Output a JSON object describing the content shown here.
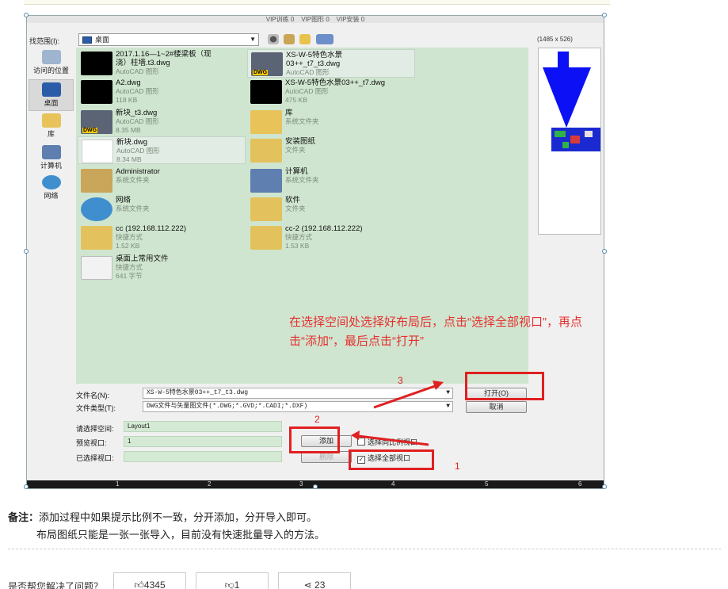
{
  "screenshot": {
    "top_text": "VIP训练 0    VIP图形 0    VIP安装 0",
    "look_in_label": "找范围(I):",
    "look_in_value": "桌面",
    "preview_dims": "(1485 x 526)",
    "places": [
      {
        "label": "访问的位置",
        "icon": "recent-places-icon"
      },
      {
        "label": "桌面",
        "icon": "desktop-icon",
        "selected": true
      },
      {
        "label": "库",
        "icon": "library-icon"
      },
      {
        "label": "计算机",
        "icon": "computer-icon"
      },
      {
        "label": "网络",
        "icon": "network-icon"
      }
    ],
    "files": [
      {
        "name": "2017.1.16—1~2#楼梁板（现",
        "name2": "浇）柱墙.t3.dwg",
        "type": "AutoCAD 图形",
        "size": "",
        "icon": "dwg-thumbnail"
      },
      {
        "name": "XS-W-5特色水景",
        "name2": "03++_t7_t3.dwg",
        "type": "AutoCAD 图形",
        "size": "",
        "icon": "dwg-file-icon"
      },
      {
        "name": "A2.dwg",
        "name2": "",
        "type": "AutoCAD 图形",
        "size": "118 KB",
        "icon": "dwg-thumbnail"
      },
      {
        "name": "XS-W-5特色水景03++_t7.dwg",
        "name2": "",
        "type": "AutoCAD 图形",
        "size": "475 KB",
        "icon": "dwg-thumbnail"
      },
      {
        "name": "新块_t3.dwg",
        "name2": "",
        "type": "AutoCAD 图形",
        "size": "8.35 MB",
        "icon": "dwg-file-icon"
      },
      {
        "name": "库",
        "name2": "",
        "type": "系统文件夹",
        "size": "",
        "icon": "library-folder-icon"
      },
      {
        "name": "新块.dwg",
        "name2": "",
        "type": "AutoCAD 图形",
        "size": "8.34 MB",
        "icon": "dwg-thumbnail"
      },
      {
        "name": "安装图纸",
        "name2": "",
        "type": "文件夹",
        "size": "",
        "icon": "folder-icon"
      },
      {
        "name": "Administrator",
        "name2": "",
        "type": "系统文件夹",
        "size": "",
        "icon": "user-folder-icon"
      },
      {
        "name": "计算机",
        "name2": "",
        "type": "系统文件夹",
        "size": "",
        "icon": "computer-icon"
      },
      {
        "name": "网络",
        "name2": "",
        "type": "系统文件夹",
        "size": "",
        "icon": "network-icon"
      },
      {
        "name": "软件",
        "name2": "",
        "type": "文件夹",
        "size": "",
        "icon": "folder-icon"
      },
      {
        "name": "cc (192.168.112.222)",
        "name2": "",
        "type": "快捷方式",
        "size": "1.52 KB",
        "icon": "shortcut-folder-icon"
      },
      {
        "name": "cc-2 (192.168.112.222)",
        "name2": "",
        "type": "快捷方式",
        "size": "1.53 KB",
        "icon": "shortcut-folder-icon"
      },
      {
        "name": "桌面上常用文件",
        "name2": "",
        "type": "快捷方式",
        "size": "641 字节",
        "icon": "shortcut-folder-icon"
      }
    ],
    "annotation": "在选择空间处选择好布局后，点击“选择全部视口”，再点击“添加”，最后点击“打开”",
    "filename_label": "文件名(N):",
    "filename_value": "XS-W-5特色水景03++_t7_t3.dwg",
    "filetype_label": "文件类型(T):",
    "filetype_value": "DWG文件与矢量图文件(*.DWG;*.GVD;*.CADI;*.DXF)",
    "open_button": "打开(O)",
    "cancel_button": "取消",
    "space_label": "请选择空间:",
    "space_value": "Layout1",
    "preview_label": "预览视口:",
    "preview_value": "1",
    "selected_label": "已选择视口:",
    "add_button": "添加",
    "delete_button": "删除",
    "checkbox_ratio": "选择同比例视口",
    "checkbox_all": "选择全部视口",
    "step_numbers": [
      "1",
      "2",
      "3"
    ],
    "bottom_tabs": [
      "1",
      "2",
      "3",
      "4",
      "5",
      "6"
    ]
  },
  "note": {
    "label": "备注：",
    "line1": "添加过程中如果提示比例不一致，分开添加，分开导入即可。",
    "line2": "布局图纸只能是一张一张导入，目前没有快速批量导入的方法。"
  },
  "feedback": {
    "question": "是否帮您解决了问题？",
    "like_count": "4345",
    "dislike_count": "1",
    "share_count": "23"
  },
  "colors": {
    "file_list_bg": "#cfe5cf",
    "annotation_red": "#e63030",
    "preview_blue": "#0b10f5"
  }
}
